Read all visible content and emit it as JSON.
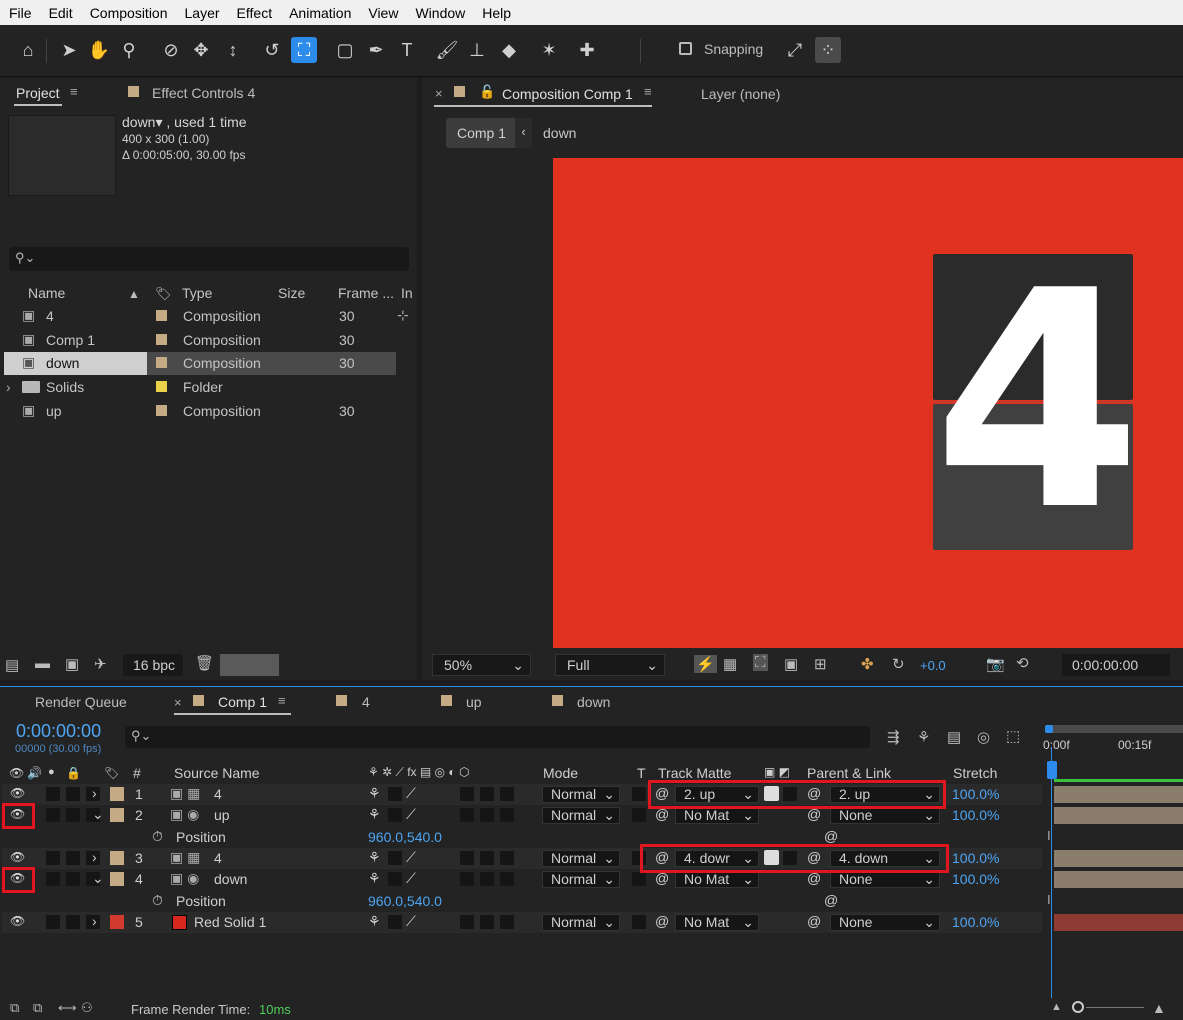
{
  "menu": [
    "File",
    "Edit",
    "Composition",
    "Layer",
    "Effect",
    "Animation",
    "View",
    "Window",
    "Help"
  ],
  "toolbar": {
    "snapping_label": "Snapping"
  },
  "project_panel": {
    "tab_project": "Project",
    "tab_effect_controls": "Effect Controls 4",
    "item_name": "down▾ , used 1 time",
    "item_dims": "400 x 300 (1.00)",
    "item_duration": "Δ 0:00:05:00, 30.00 fps",
    "search_placeholder": "",
    "columns": {
      "name": "Name",
      "type": "Type",
      "size": "Size",
      "frame": "Frame ...",
      "in": "In"
    },
    "items": [
      {
        "name": "4",
        "type": "Composition",
        "frame": "30",
        "color": "#c4ab86"
      },
      {
        "name": "Comp 1",
        "type": "Composition",
        "frame": "30",
        "color": "#c4ab86"
      },
      {
        "name": "down",
        "type": "Composition",
        "frame": "30",
        "color": "#c4ab86"
      },
      {
        "name": "Solids",
        "type": "Folder",
        "frame": "",
        "color": "#ead24a"
      },
      {
        "name": "up",
        "type": "Composition",
        "frame": "30",
        "color": "#c4ab86"
      }
    ],
    "bpc": "16 bpc"
  },
  "comp_panel": {
    "tab_comp": "Composition Comp 1",
    "tab_layer": "Layer (none)",
    "crumb_comp": "Comp 1",
    "crumb_down": "down",
    "digit": "4",
    "zoom": "50%",
    "resolution": "Full",
    "exposure": "+0.0",
    "timecode": "0:00:00:00",
    "colors": {
      "background": "#e0321f",
      "card_top": "#2b2b2b",
      "card_bottom": "#404040",
      "digit": "#ffffff"
    }
  },
  "timeline": {
    "tabs": {
      "render_queue": "Render Queue",
      "comp1": "Comp 1",
      "t4": "4",
      "up": "up",
      "down": "down"
    },
    "timecode": "0:00:00:00",
    "frames": "00000 (30.00 fps)",
    "columns": {
      "num": "#",
      "source": "Source Name",
      "mode": "Mode",
      "t": "T",
      "track_matte": "Track Matte",
      "parent": "Parent & Link",
      "stretch": "Stretch"
    },
    "ruler": {
      "start": "0:00f",
      "mid": "00:15f"
    },
    "layers": [
      {
        "num": "1",
        "name": "4",
        "mode": "Normal",
        "matte": "2. up",
        "parent": "2. up",
        "stretch": "100.0%",
        "color": "#c4ab86"
      },
      {
        "num": "2",
        "name": "up",
        "mode": "Normal",
        "matte": "No Mat",
        "parent": "None",
        "stretch": "100.0%",
        "color": "#c4ab86"
      },
      {
        "num": "3",
        "name": "4",
        "mode": "Normal",
        "matte": "4. dowr",
        "parent": "4. down",
        "stretch": "100.0%",
        "color": "#c4ab86"
      },
      {
        "num": "4",
        "name": "down",
        "mode": "Normal",
        "matte": "No Mat",
        "parent": "None",
        "stretch": "100.0%",
        "color": "#c4ab86"
      },
      {
        "num": "5",
        "name": "Red Solid 1",
        "mode": "Normal",
        "matte": "No Mat",
        "parent": "None",
        "stretch": "100.0%",
        "color": "#d23a2e"
      }
    ],
    "position_label": "Position",
    "position_value": "960.0,540.0",
    "render_time_label": "Frame Render Time:",
    "render_time_value": "10ms"
  }
}
